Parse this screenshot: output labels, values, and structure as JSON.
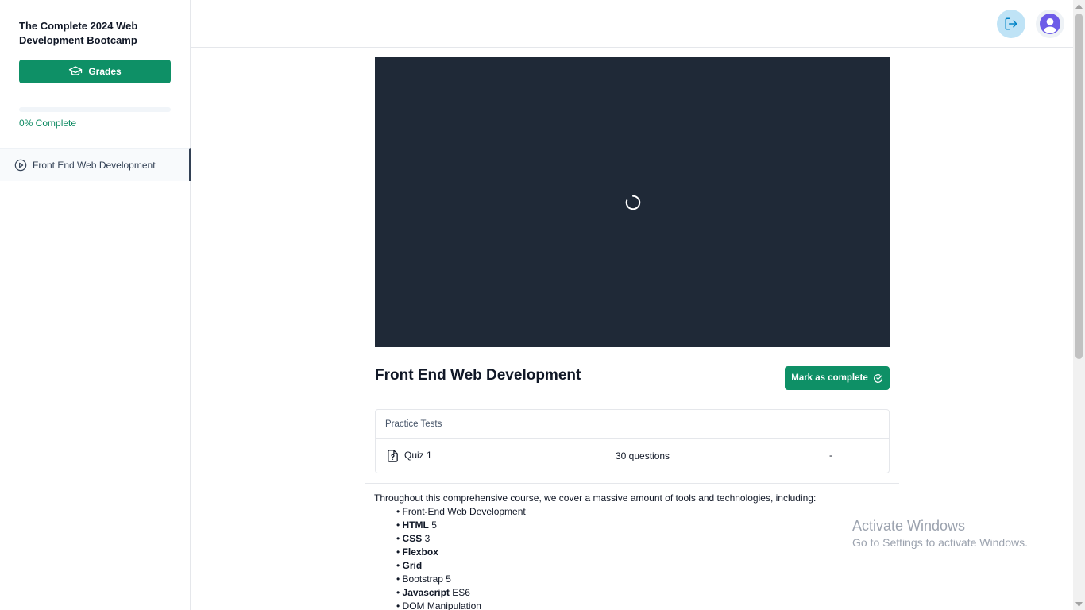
{
  "sidebar": {
    "course_title": "The Complete 2024 Web Development Bootcamp",
    "grades_label": "Grades",
    "progress_percent": 0,
    "progress_text": "0% Complete",
    "chapters": [
      {
        "label": "Front End Web Development",
        "icon": "play-circle-icon",
        "active": true
      }
    ]
  },
  "header": {
    "logout_icon": "logout-icon",
    "avatar_icon": "user-avatar-icon"
  },
  "main": {
    "video_state": "loading",
    "chapter_title": "Front End Web Development",
    "mark_complete_label": "Mark as complete",
    "practice_tests": {
      "heading": "Practice Tests",
      "rows": [
        {
          "name": "Quiz 1",
          "questions": "30 questions",
          "score": "-"
        }
      ]
    },
    "description": {
      "intro": "Throughout this comprehensive course, we cover a massive amount of tools and technologies, including:",
      "items": [
        {
          "bold": "",
          "text": "Front-End Web Development"
        },
        {
          "bold": "HTML",
          "text": " 5"
        },
        {
          "bold": "CSS",
          "text": " 3"
        },
        {
          "bold": "Flexbox",
          "text": ""
        },
        {
          "bold": "Grid",
          "text": ""
        },
        {
          "bold": "",
          "text": "Bootstrap 5"
        },
        {
          "bold": "Javascript",
          "text": " ES6"
        },
        {
          "bold": "",
          "text": "DOM Manipulation"
        }
      ]
    }
  },
  "watermark": {
    "title": "Activate Windows",
    "subtitle": "Go to Settings to activate Windows."
  },
  "colors": {
    "brand_green": "#0e9066",
    "video_bg": "#1f2937",
    "logout_bg": "#bfe3f6"
  }
}
